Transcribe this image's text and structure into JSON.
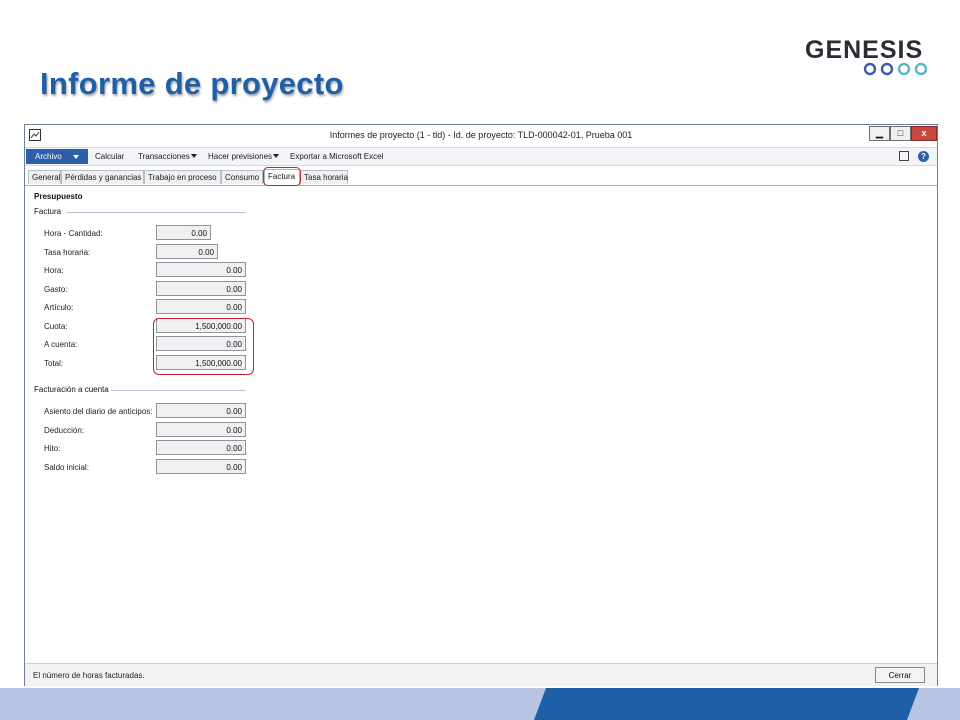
{
  "slide": {
    "title": "Informe de proyecto",
    "logo_text": "GENESIS",
    "logo_ring_colors": [
      "#3a5fa8",
      "#3a5fa8",
      "#5cb3c9",
      "#5cb3c9"
    ]
  },
  "window": {
    "title": "Informes de proyecto (1 - tld) - Id. de proyecto: TLD-000042-01, Prueba 001",
    "controls": {
      "minimize": "▁",
      "maximize": "□",
      "close": "x"
    }
  },
  "actionbar": {
    "file_menu": "Archivo",
    "items": [
      "Calcular",
      "Transacciones",
      "Hacer previsiones",
      "Exportar a Microsoft Excel"
    ]
  },
  "tabs": [
    {
      "label": "General",
      "active": false
    },
    {
      "label": "Pérdidas y ganancias",
      "active": false
    },
    {
      "label": "Trabajo en proceso",
      "active": false
    },
    {
      "label": "Consumo",
      "active": false
    },
    {
      "label": "Factura",
      "active": true
    },
    {
      "label": "Tasa horaria",
      "active": false
    }
  ],
  "content": {
    "section_title": "Presupuesto",
    "factura": {
      "group_label": "Factura",
      "fields": [
        {
          "label": "Hora - Cantidad:",
          "value": "0.00"
        },
        {
          "label": "Tasa horaria:",
          "value": "0.00"
        },
        {
          "label": "Hora:",
          "value": "0.00"
        },
        {
          "label": "Gasto:",
          "value": "0.00"
        },
        {
          "label": "Artículo:",
          "value": "0.00"
        },
        {
          "label": "Cuota:",
          "value": "1,500,000.00"
        },
        {
          "label": "A cuenta:",
          "value": "0.00"
        },
        {
          "label": "Total:",
          "value": "1,500,000.00"
        }
      ]
    },
    "facturacion": {
      "group_label": "Facturación a cuenta",
      "fields": [
        {
          "label": "Asiento del diario de anticipos:",
          "value": "0.00"
        },
        {
          "label": "Deducción:",
          "value": "0.00"
        },
        {
          "label": "Hito:",
          "value": "0.00"
        },
        {
          "label": "Saldo inicial:",
          "value": "0.00"
        }
      ]
    }
  },
  "status": {
    "text": "El número de horas facturadas.",
    "close_button": "Cerrar"
  },
  "colors": {
    "title_blue": "#1f5fa8",
    "archivo_blue": "#2e5ea8",
    "highlight_red": "#c4232f",
    "band": "#b7c4e3"
  }
}
